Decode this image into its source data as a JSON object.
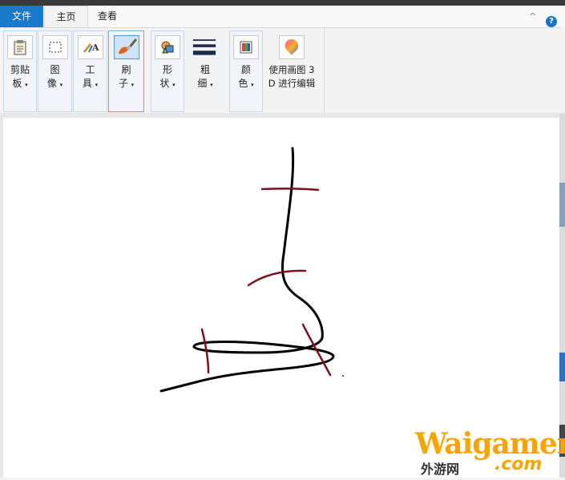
{
  "tabs": {
    "file": "文件",
    "home": "主页",
    "view": "查看"
  },
  "ribbon": {
    "clipboard": {
      "line1": "剪贴",
      "line2": "板"
    },
    "image": {
      "line1": "图",
      "line2": "像"
    },
    "tools": {
      "line1": "工",
      "line2": "具"
    },
    "brushes": {
      "line1": "刷",
      "line2": "子"
    },
    "shapes": {
      "line1": "形",
      "line2": "状"
    },
    "size": {
      "line1": "粗",
      "line2": "细"
    },
    "colors": {
      "line1": "颜",
      "line2": "色"
    },
    "paint3d": {
      "line1": "使用画图 3",
      "line2": "D 进行编辑"
    },
    "dropdown_caret": "▾"
  },
  "title_controls": {
    "collapse": "^",
    "help": "?"
  },
  "colors": {
    "accent": "#1979ca",
    "stroke_black": "#000000",
    "stroke_dark_red": "#7b1020"
  },
  "watermark": {
    "text_en": "Waigamer",
    "text_cn": "外游网",
    "text_com": ".com"
  }
}
